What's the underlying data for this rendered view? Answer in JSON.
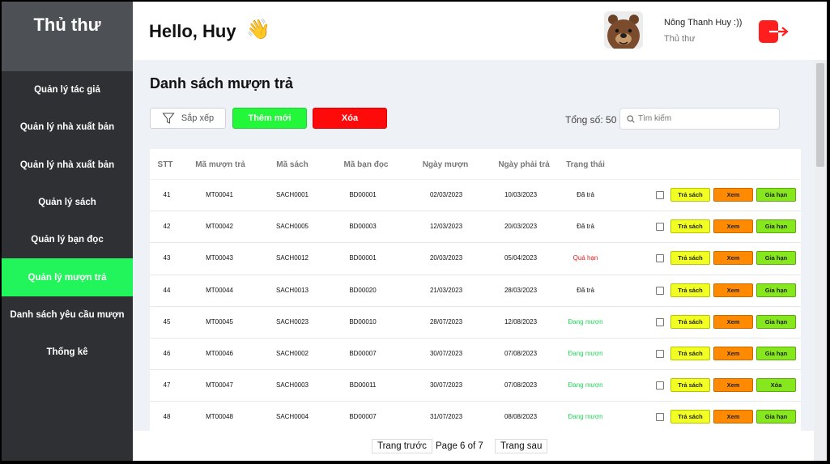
{
  "sidebar": {
    "title": "Thủ thư",
    "items": [
      {
        "label": "Quản lý tác giả",
        "active": false
      },
      {
        "label": "Quản lý nhà xuất bản",
        "active": false
      },
      {
        "label": "Quản lý nhà xuất bản",
        "active": false
      },
      {
        "label": "Quản lý sách",
        "active": false
      },
      {
        "label": "Quản lý bạn đọc",
        "active": false
      },
      {
        "label": "Quản lý mượn trả",
        "active": true
      },
      {
        "label": "Danh sách yêu cầu mượn",
        "active": false
      },
      {
        "label": "Thống kê",
        "active": false
      }
    ]
  },
  "header": {
    "greeting": "Hello, Huy",
    "wave_emoji": "👋",
    "user_name": "Nông Thanh Huy :))",
    "user_role": "Thủ thư",
    "avatar_icon": "bear-avatar",
    "logout_icon": "logout-icon"
  },
  "main": {
    "title": "Danh sách mượn trả",
    "sort_label": "Sắp xếp",
    "add_label": "Thêm mới",
    "delete_label": "Xóa",
    "total_label": "Tổng số: 50",
    "search_placeholder": "Tìm kiếm",
    "search_value": ""
  },
  "table": {
    "columns": [
      "STT",
      "Mã mượn trả",
      "Mã sách",
      "Mã bạn đọc",
      "Ngày mượn",
      "Ngày phải trả",
      "Trạng thái"
    ],
    "rows": [
      {
        "stt": "41",
        "loan_id": "MT00041",
        "book_id": "SACH0001",
        "reader_id": "BD00001",
        "borrow_date": "02/03/2023",
        "due_date": "10/03/2023",
        "status": "Đã trả",
        "status_color": "#111111",
        "actions": [
          "Trả sách",
          "Xem",
          "Gia hạn"
        ]
      },
      {
        "stt": "42",
        "loan_id": "MT00042",
        "book_id": "SACH0005",
        "reader_id": "BD00003",
        "borrow_date": "12/03/2023",
        "due_date": "20/03/2023",
        "status": "Đã trả",
        "status_color": "#111111",
        "actions": [
          "Trả sách",
          "Xem",
          "Gia hạn"
        ]
      },
      {
        "stt": "43",
        "loan_id": "MT00043",
        "book_id": "SACH0012",
        "reader_id": "BD00001",
        "borrow_date": "20/03/2023",
        "due_date": "05/04/2023",
        "status": "Quá hạn",
        "status_color": "#e21b1b",
        "actions": [
          "Trả sách",
          "Xem",
          "Gia hạn"
        ]
      },
      {
        "stt": "44",
        "loan_id": "MT00044",
        "book_id": "SACH0013",
        "reader_id": "BD00020",
        "borrow_date": "21/03/2023",
        "due_date": "28/03/2023",
        "status": "Đã trả",
        "status_color": "#111111",
        "actions": [
          "Trả sách",
          "Xem",
          "Gia hạn"
        ]
      },
      {
        "stt": "45",
        "loan_id": "MT00045",
        "book_id": "SACH0023",
        "reader_id": "BD00010",
        "borrow_date": "28/07/2023",
        "due_date": "12/08/2023",
        "status": "Đang mượn",
        "status_color": "#22d85a",
        "actions": [
          "Trả sách",
          "Xem",
          "Gia hạn"
        ]
      },
      {
        "stt": "46",
        "loan_id": "MT00046",
        "book_id": "SACH0002",
        "reader_id": "BD00007",
        "borrow_date": "30/07/2023",
        "due_date": "07/08/2023",
        "status": "Đang mượn",
        "status_color": "#22d85a",
        "actions": [
          "Trả sách",
          "Xem",
          "Gia hạn"
        ]
      },
      {
        "stt": "47",
        "loan_id": "MT00047",
        "book_id": "SACH0003",
        "reader_id": "BD00011",
        "borrow_date": "30/07/2023",
        "due_date": "07/08/2023",
        "status": "Đang mượn",
        "status_color": "#22d85a",
        "actions": [
          "Trả sách",
          "Xem",
          "Xóa"
        ]
      },
      {
        "stt": "48",
        "loan_id": "MT00048",
        "book_id": "SACH0004",
        "reader_id": "BD00007",
        "borrow_date": "31/07/2023",
        "due_date": "08/08/2023",
        "status": "Đang mượn",
        "status_color": "#22d85a",
        "actions": [
          "Trả sách",
          "Xem",
          "Gia hạn"
        ]
      }
    ]
  },
  "pagination": {
    "prev_label": "Trang trước",
    "info": "Page 6 of 7",
    "next_label": "Trang sau"
  },
  "colors": {
    "sidebar_bg": "#2e3033",
    "active_nav": "#22f45c",
    "add_button": "#22f73a",
    "delete_button": "#ff0a0a",
    "return_button": "#f1ff22",
    "view_button": "#ff8a00",
    "extend_button": "#86e81c"
  }
}
